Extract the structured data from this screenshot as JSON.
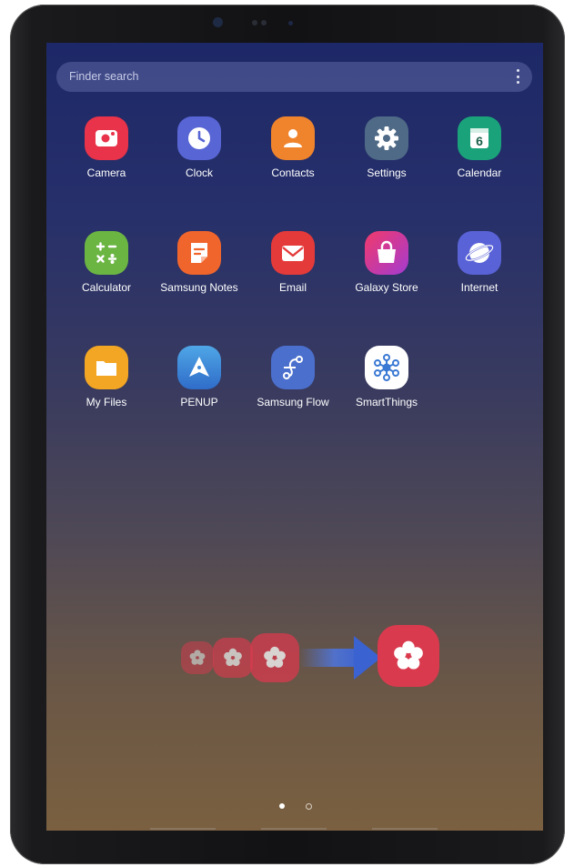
{
  "search": {
    "placeholder": "Finder search"
  },
  "apps": [
    {
      "label": "Camera",
      "icon": "camera-icon",
      "color": "#e8334a"
    },
    {
      "label": "Clock",
      "icon": "clock-icon",
      "color": "#5865d4"
    },
    {
      "label": "Contacts",
      "icon": "contacts-icon",
      "color": "#f0842c"
    },
    {
      "label": "Settings",
      "icon": "settings-icon",
      "color": "#4f6a86"
    },
    {
      "label": "Calendar",
      "icon": "calendar-icon",
      "color": "#1aa37a",
      "badge": "6"
    },
    {
      "label": "Calculator",
      "icon": "calculator-icon",
      "color": "#6bb543"
    },
    {
      "label": "Samsung Notes",
      "icon": "samsung-notes-icon",
      "color": "#f0652c"
    },
    {
      "label": "Email",
      "icon": "email-icon",
      "color": "#e43a3a"
    },
    {
      "label": "Galaxy Store",
      "icon": "galaxy-store-icon",
      "color": "#e53873"
    },
    {
      "label": "Internet",
      "icon": "internet-icon",
      "color": "#5962d6"
    },
    {
      "label": "My Files",
      "icon": "my-files-icon",
      "color": "#f3a623"
    },
    {
      "label": "PENUP",
      "icon": "penup-icon",
      "color": "#3f8ad8"
    },
    {
      "label": "Samsung Flow",
      "icon": "samsung-flow-icon",
      "color": "#4b6fcd"
    },
    {
      "label": "SmartThings",
      "icon": "smartthings-icon",
      "color": "#ffffff"
    }
  ],
  "overlay": {
    "icon": "bixby-flower-icon",
    "arrow": "arrow-right-icon",
    "color": "#d93a4e"
  },
  "pager": {
    "pages": 2,
    "current": 1
  }
}
